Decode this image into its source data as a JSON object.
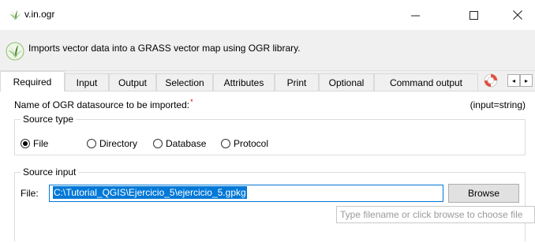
{
  "window": {
    "title": "v.in.ogr",
    "controls": {
      "minimize": "—",
      "maximize": "☐",
      "close": "✕"
    }
  },
  "banner": {
    "description": "Imports vector data into a GRASS vector map using OGR library."
  },
  "tabs": [
    {
      "label": "Required",
      "active": true
    },
    {
      "label": "Input"
    },
    {
      "label": "Output"
    },
    {
      "label": "Selection"
    },
    {
      "label": "Attributes"
    },
    {
      "label": "Print"
    },
    {
      "label": "Optional"
    },
    {
      "label": "Command output"
    }
  ],
  "tab_scroll": {
    "left": "◂",
    "right": "▸"
  },
  "required": {
    "datasource_label": "Name of OGR datasource to be imported:",
    "required_marker": "*",
    "hint": "(input=string)",
    "source_type": {
      "title": "Source type",
      "options": [
        {
          "label": "File",
          "selected": true
        },
        {
          "label": "Directory",
          "selected": false
        },
        {
          "label": "Database",
          "selected": false
        },
        {
          "label": "Protocol",
          "selected": false
        }
      ]
    },
    "source_input": {
      "title": "Source input",
      "file_label": "File:",
      "file_value": "C:\\Tutorial_QGIS\\Ejercicio_5\\ejercicio_5.gpkg",
      "browse_label": "Browse",
      "tooltip": "Type filename or click browse to choose file"
    }
  },
  "colors": {
    "accent": "#0078d7",
    "required": "#e00000",
    "panel_bg": "#f0f0f0"
  }
}
